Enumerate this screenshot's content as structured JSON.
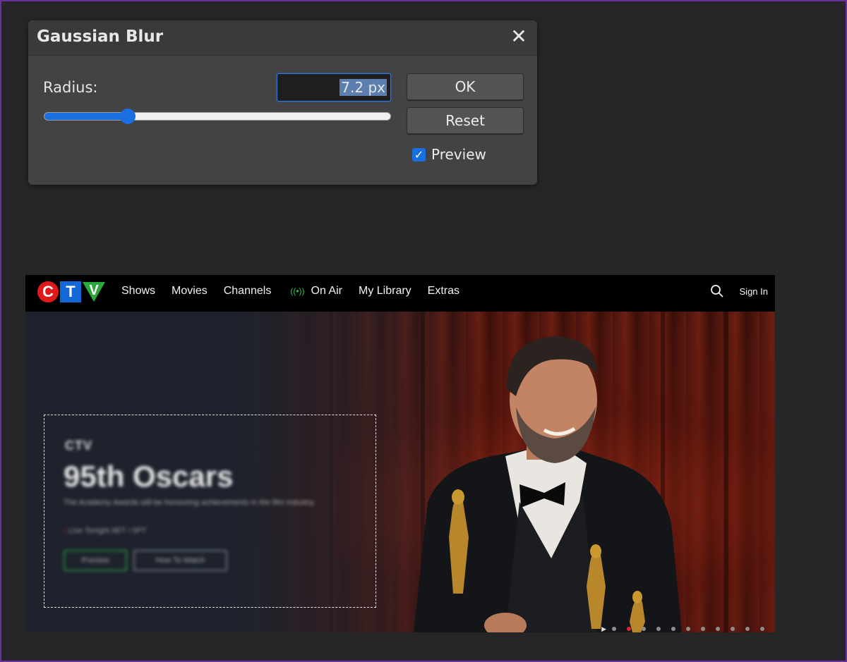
{
  "dialog": {
    "title": "Gaussian Blur",
    "close_icon": "close-icon",
    "radius_label": "Radius:",
    "radius_value": "7.2 px",
    "slider_fraction": 0.24,
    "ok_label": "OK",
    "reset_label": "Reset",
    "preview_label": "Preview",
    "preview_checked": true,
    "accent_color": "#1a6fe0"
  },
  "webpage": {
    "logo_letters": [
      "C",
      "T",
      "V"
    ],
    "nav": [
      "Shows",
      "Movies",
      "Channels",
      "On Air",
      "My Library",
      "Extras"
    ],
    "onair_icon": "broadcast-icon",
    "search_icon": "search-icon",
    "signin_label": "Sign In",
    "promo": {
      "network": "CTV",
      "title": "95th Oscars",
      "description": "The Academy Awards will be honouring achievements in the film industry.",
      "airtime": "Live Tonight 8ET / 5PT",
      "preview_button": "Preview",
      "howto_button": "How To Watch"
    },
    "carousel_active_index": 1,
    "carousel_count": 11
  }
}
